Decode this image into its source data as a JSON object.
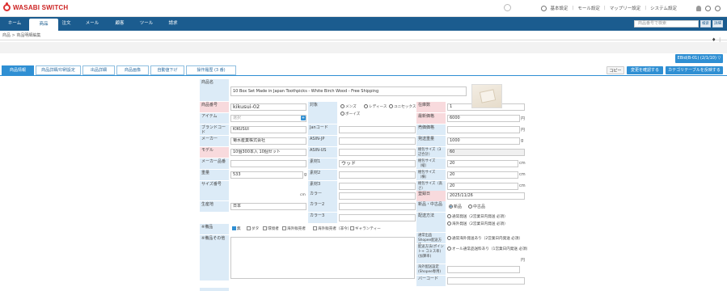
{
  "app": {
    "logo_text": "WASABI SWITCH"
  },
  "topbar": {
    "links": [
      "基本設定",
      "モール設定",
      "マップリー設定",
      "システム設定"
    ],
    "icons": [
      "user-icon",
      "bell-icon",
      "info-icon",
      "settings-icon"
    ]
  },
  "nav": {
    "items": [
      "ホーム",
      "商品",
      "注文",
      "メール",
      "顧客",
      "ツール",
      "請求"
    ],
    "active_index": 1,
    "search_placeholder": "商品番号で検索",
    "btn_search": "検索",
    "btn_detail": "詳細"
  },
  "breadcrumb": "商品 > 商品明細編集",
  "ebid_button": "EBid(B-01) (2/1/10) ▽",
  "tabs": [
    "商品情報",
    "商品詳細/印刷設定",
    "出品詳細",
    "商品画像",
    "自動値下げ",
    "操作履歴 (3 番)"
  ],
  "right_buttons": {
    "copy": "コピー",
    "confirm_change": "変更を確認する",
    "category_table": "カテゴリテーブルを反映する"
  },
  "colors": {
    "nav": "#1b5c8f",
    "accent": "#2f8fd3",
    "label_blue": "#dcebf7",
    "label_pink": "#f8dadd",
    "orange": "#e8802c"
  },
  "form": {
    "product_name_label": "商品名",
    "product_name": "10 Box Set Made in Japan Toothpicks - White Birch Wood - Free Shipping",
    "fields_left": [
      {
        "label": "商品番号",
        "value": "kikusui-02"
      },
      {
        "label": "アイテム",
        "value": "選択"
      },
      {
        "label": "ブランドコード",
        "value": "KIKUSUI"
      },
      {
        "label": "メーカー",
        "value": "菊水産業株式会社"
      },
      {
        "label": "モデル",
        "value": "10個300本入 10個セット"
      },
      {
        "label": "メーカー品番",
        "value": ""
      },
      {
        "label": "重量",
        "value": "533",
        "unit": "g"
      },
      {
        "label": "サイズ番号",
        "value": "",
        "unit": "cm"
      },
      {
        "label": "生産地",
        "value": "日本"
      }
    ],
    "fields_mid": [
      {
        "label": "対象",
        "value": ""
      },
      {
        "label": "Janコード",
        "value": ""
      },
      {
        "label": "ASIN-JP",
        "value": ""
      },
      {
        "label": "ASIN-US",
        "value": ""
      },
      {
        "label": "素材1",
        "value": "ウッド"
      },
      {
        "label": "素材2",
        "value": ""
      },
      {
        "label": "素材3",
        "value": ""
      },
      {
        "label": "カラー",
        "value": ""
      },
      {
        "label": "カラー2",
        "value": ""
      },
      {
        "label": "カラー3",
        "value": ""
      }
    ],
    "target_options": [
      "メンズ",
      "レディース",
      "ユニセックス",
      "ボーイズ"
    ],
    "fields_right": [
      {
        "label": "在庫数",
        "value": "1"
      },
      {
        "label": "最新価格",
        "value": "6000",
        "unit": "円"
      },
      {
        "label": "売価価格",
        "value": "",
        "unit": "円"
      },
      {
        "label": "発送重量",
        "value": "1000",
        "unit": "g"
      },
      {
        "label": "梱包サイズ（3辺合計）",
        "value": "60"
      },
      {
        "label": "梱包サイズ（縦）",
        "value": "20",
        "unit": "cm"
      },
      {
        "label": "梱包サイズ（横）",
        "value": "20",
        "unit": "cm"
      },
      {
        "label": "梱包サイズ（高さ）",
        "value": "20",
        "unit": "cm"
      },
      {
        "label": "登録日",
        "value": "2025/11/26"
      }
    ],
    "new_used_label": "新品・中古品",
    "new_used_options": [
      "新品",
      "中古品"
    ],
    "shipping_label": "配送方法",
    "shipping_options": [
      "通常発送（2営業日内発送 必須）",
      "海外発送（2営業日内発送 必須）"
    ],
    "quantity_label": "※備品",
    "quantity_options": [
      "無",
      "ダタ",
      "環境者",
      "海外販売者",
      "海外販売者（非今）",
      "ギャランティー"
    ],
    "notes_label": "※備品その他",
    "bottom_fields": [
      {
        "label": "通常出品Shopee配送方法",
        "option": "通常海外発送あり（2営業日内発送 必須）"
      },
      {
        "label": "配送方法(ポイント+ コミス率)(加算率)",
        "option": "オール通常品送料あり（1営業日内発送 必須）"
      },
      {
        "label": "海外配送設定(Shopee専用)",
        "value": "",
        "unit": "円"
      },
      {
        "label": "バーコード",
        "value": ""
      }
    ]
  }
}
